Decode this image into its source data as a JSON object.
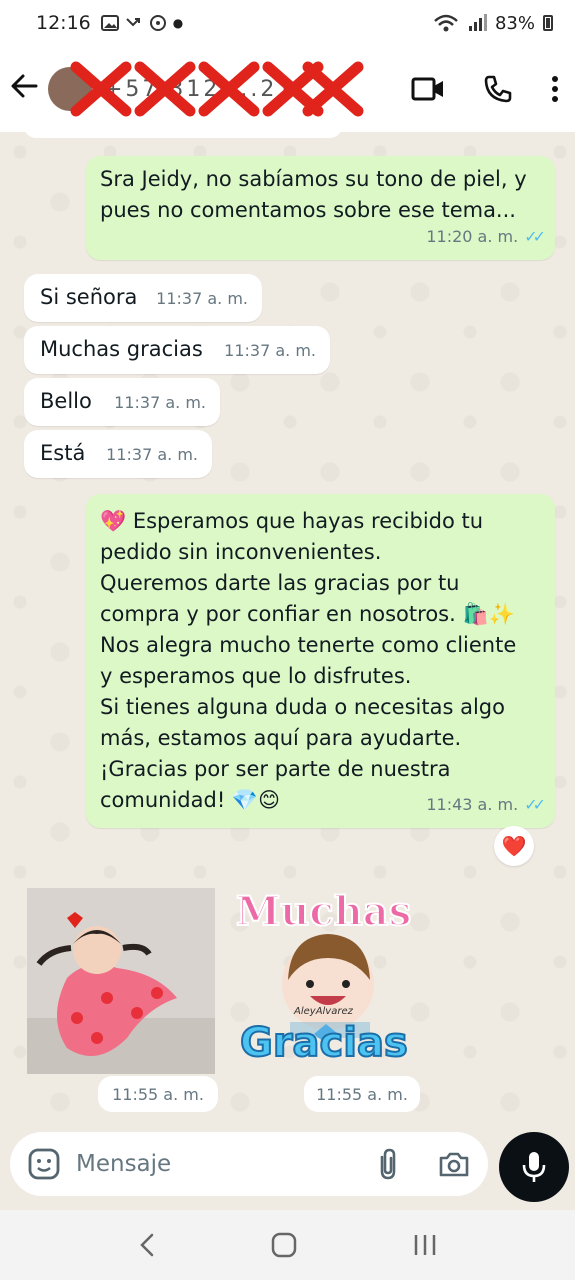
{
  "status_bar": {
    "time": "12:16",
    "battery": "83%"
  },
  "header": {
    "contact_name": "+57 312 ...21"
  },
  "messages": [
    {
      "dir": "out",
      "text": "Sra Jeidy, no sabíamos su tono de piel, y pues no comentamos sobre ese tema...",
      "time": "11:20 a. m."
    },
    {
      "dir": "in",
      "text": "Si señora",
      "time": "11:37 a. m."
    },
    {
      "dir": "in",
      "text": "Muchas gracias",
      "time": "11:37 a. m."
    },
    {
      "dir": "in",
      "text": "Bello",
      "time": "11:37 a. m."
    },
    {
      "dir": "in",
      "text": "Está",
      "time": "11:37 a. m."
    },
    {
      "dir": "out",
      "time": "11:43 a. m.",
      "lines": [
        "💖 Esperamos que hayas recibido tu",
        "pedido sin inconvenientes.",
        "Queremos darte las gracias por tu",
        "compra y por confiar en nosotros. 🛍️✨",
        "Nos alegra mucho tenerte como cliente",
        "y esperamos que lo disfrutes.",
        "Si tienes alguna duda o necesitas algo",
        "más, estamos aquí para ayudarte.",
        "¡Gracias por ser parte de nuestra",
        "comunidad! 💎😊"
      ]
    }
  ],
  "reaction": "❤️",
  "media": [
    {
      "type": "photo",
      "time": "11:55 a. m."
    },
    {
      "type": "sticker",
      "time": "11:55 a. m.",
      "sticker_text_top": "Muchas",
      "sticker_text_bottom": "Gracias",
      "sticker_signature": "AleyAlvarez"
    }
  ],
  "input": {
    "placeholder": "Mensaje"
  },
  "colors": {
    "outgoing_bubble": "#dcf8c6",
    "incoming_bubble": "#ffffff",
    "chat_background": "#efeae2",
    "read_ticks": "#53bdeb"
  },
  "icons": [
    "back-arrow-icon",
    "video-call-icon",
    "phone-icon",
    "more-options-icon",
    "sticker-icon",
    "attach-icon",
    "camera-icon",
    "mic-icon",
    "nav-back-icon",
    "nav-home-icon",
    "nav-recents-icon"
  ]
}
